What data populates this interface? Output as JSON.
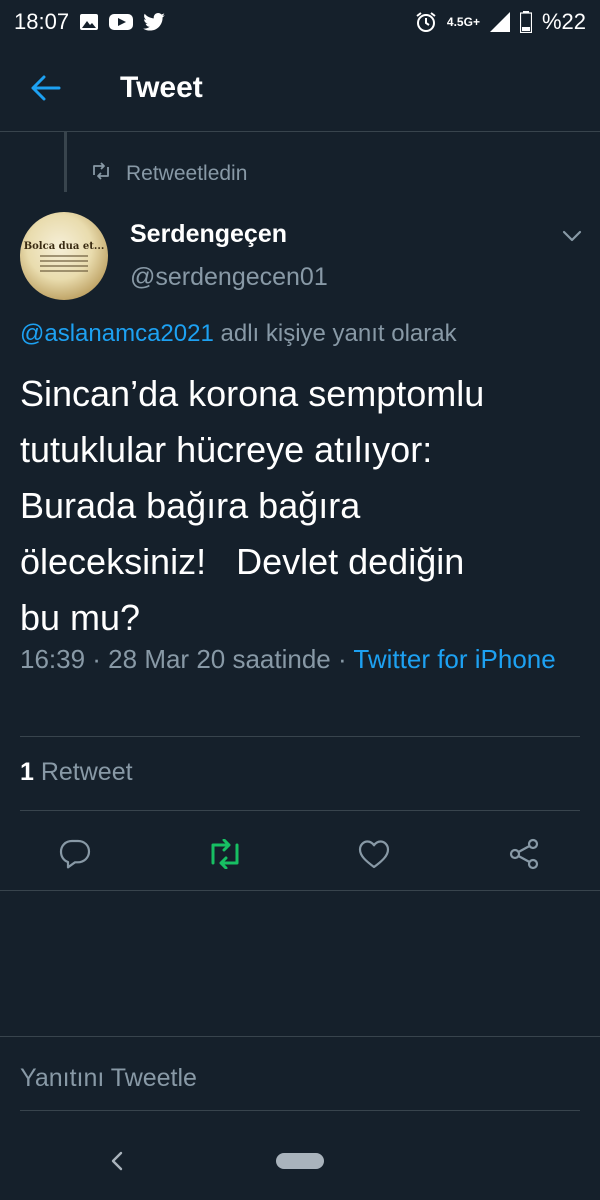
{
  "status_bar": {
    "time": "18:07",
    "left_icons": [
      "image-icon",
      "youtube-icon",
      "twitter-icon"
    ],
    "right_icons": [
      "alarm-icon",
      "network-4g-icon",
      "signal-icon",
      "battery-icon"
    ],
    "network_label": "4.5G+",
    "battery": "%22"
  },
  "header": {
    "title": "Tweet"
  },
  "tweet": {
    "retweet_note": "Retweetledin",
    "author_name": "Serdengeçen",
    "author_handle": "@serdengecen01",
    "avatar_text": "Bolca dua et...",
    "reply_mention": "@aslanamca2021",
    "reply_suffix": " adlı kişiye yanıt olarak",
    "text": "Sincan’da korona semptomlu\ntutuklular hücreye atılıyor:\nBurada bağıra bağıra\nöleceksiniz!   Devlet dediğin\nbu mu?",
    "meta_prefix": "16:39 · 28 Mar 20 saatinde · ",
    "source": "Twitter for iPhone",
    "retweet_count": "1",
    "retweet_label": " Retweet"
  },
  "actions": [
    "reply-icon",
    "retweet-icon",
    "like-icon",
    "share-icon"
  ],
  "colors": {
    "background": "#15202b",
    "accent": "#1da1f2",
    "secondary_text": "#8899a6",
    "retweet_active": "#17bf63",
    "divider": "#38444d"
  },
  "reply_box": {
    "placeholder": "Yanıtını Tweetle"
  }
}
